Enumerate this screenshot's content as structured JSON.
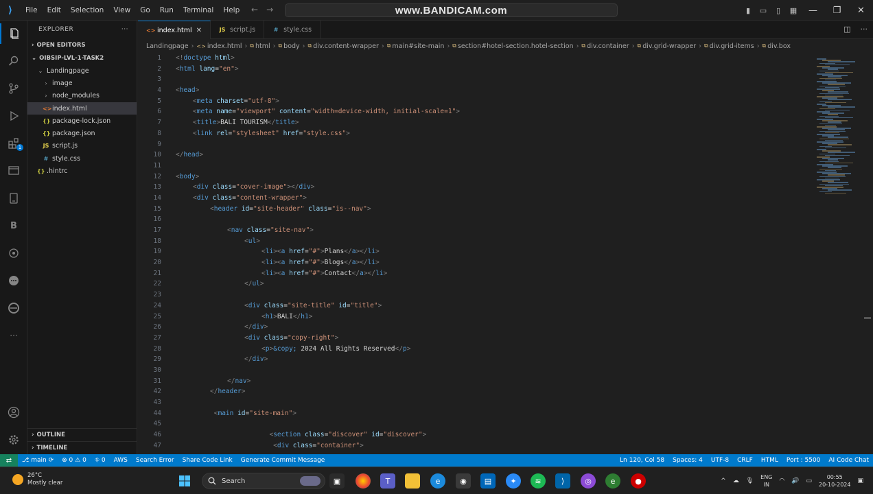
{
  "window": {
    "watermark": "www.BANDICAM.com",
    "menu": [
      "File",
      "Edit",
      "Selection",
      "View",
      "Go",
      "Run",
      "Terminal",
      "Help"
    ]
  },
  "sidebar": {
    "title": "EXPLORER",
    "more": "···",
    "open_editors": "OPEN EDITORS",
    "workspace": "OIBSIP-LVL-1-TASK2",
    "tree": [
      {
        "label": "Landingpage",
        "depth": 1,
        "kind": "folder-open",
        "selected": false
      },
      {
        "label": "image",
        "depth": 2,
        "kind": "folder",
        "selected": false
      },
      {
        "label": "node_modules",
        "depth": 2,
        "kind": "folder",
        "selected": false
      },
      {
        "label": "index.html",
        "depth": 2,
        "kind": "html",
        "selected": true
      },
      {
        "label": "package-lock.json",
        "depth": 2,
        "kind": "json",
        "selected": false
      },
      {
        "label": "package.json",
        "depth": 2,
        "kind": "json",
        "selected": false
      },
      {
        "label": "script.js",
        "depth": 2,
        "kind": "js",
        "selected": false
      },
      {
        "label": "style.css",
        "depth": 2,
        "kind": "css",
        "selected": false
      },
      {
        "label": ".hintrc",
        "depth": 1,
        "kind": "config",
        "selected": false
      }
    ],
    "outline": "OUTLINE",
    "timeline": "TIMELINE"
  },
  "tabs": [
    {
      "label": "index.html",
      "active": true,
      "kind": "html"
    },
    {
      "label": "script.js",
      "active": false,
      "kind": "js"
    },
    {
      "label": "style.css",
      "active": false,
      "kind": "css"
    }
  ],
  "breadcrumb": [
    "Landingpage",
    "index.html",
    "html",
    "body",
    "div.content-wrapper",
    "main#site-main",
    "section#hotel-section.hotel-section",
    "div.container",
    "div.grid-wrapper",
    "div.grid-items",
    "div.box"
  ],
  "code": [
    {
      "n": "1",
      "indent": 0,
      "t": [
        [
          "p",
          "<!"
        ],
        [
          "g",
          "doctype "
        ],
        [
          "a",
          "html"
        ],
        [
          "p",
          ">"
        ]
      ]
    },
    {
      "n": "2",
      "indent": 0,
      "t": [
        [
          "p",
          "<"
        ],
        [
          "g",
          "html "
        ],
        [
          "a",
          "lang"
        ],
        [
          "x",
          "="
        ],
        [
          "s",
          "\"en\""
        ],
        [
          "p",
          ">"
        ]
      ]
    },
    {
      "n": "3",
      "indent": 0,
      "t": []
    },
    {
      "n": "4",
      "indent": 0,
      "t": [
        [
          "p",
          "<"
        ],
        [
          "g",
          "head"
        ],
        [
          "p",
          ">"
        ]
      ]
    },
    {
      "n": "5",
      "indent": 1,
      "t": [
        [
          "p",
          "<"
        ],
        [
          "g",
          "meta "
        ],
        [
          "a",
          "charset"
        ],
        [
          "x",
          "="
        ],
        [
          "s",
          "\"utf-8\""
        ],
        [
          "p",
          ">"
        ]
      ]
    },
    {
      "n": "6",
      "indent": 1,
      "t": [
        [
          "p",
          "<"
        ],
        [
          "g",
          "meta "
        ],
        [
          "a",
          "name"
        ],
        [
          "x",
          "="
        ],
        [
          "s",
          "\"viewport\" "
        ],
        [
          "a",
          "content"
        ],
        [
          "x",
          "="
        ],
        [
          "s",
          "\"width=device-width, initial-scale=1\""
        ],
        [
          "p",
          ">"
        ]
      ]
    },
    {
      "n": "7",
      "indent": 1,
      "t": [
        [
          "p",
          "<"
        ],
        [
          "g",
          "title"
        ],
        [
          "p",
          ">"
        ],
        [
          "x",
          "BALI TOURISM"
        ],
        [
          "p",
          "</"
        ],
        [
          "g",
          "title"
        ],
        [
          "p",
          ">"
        ]
      ]
    },
    {
      "n": "8",
      "indent": 1,
      "t": [
        [
          "p",
          "<"
        ],
        [
          "g",
          "link "
        ],
        [
          "a",
          "rel"
        ],
        [
          "x",
          "="
        ],
        [
          "s",
          "\"stylesheet\" "
        ],
        [
          "a",
          "href"
        ],
        [
          "x",
          "="
        ],
        [
          "s",
          "\"style.css\""
        ],
        [
          "p",
          ">"
        ]
      ]
    },
    {
      "n": "9",
      "indent": 0,
      "t": []
    },
    {
      "n": "10",
      "indent": 0,
      "t": [
        [
          "p",
          "</"
        ],
        [
          "g",
          "head"
        ],
        [
          "p",
          ">"
        ]
      ]
    },
    {
      "n": "11",
      "indent": 0,
      "t": []
    },
    {
      "n": "12",
      "indent": 0,
      "t": [
        [
          "p",
          "<"
        ],
        [
          "g",
          "body"
        ],
        [
          "p",
          ">"
        ]
      ]
    },
    {
      "n": "13",
      "indent": 1,
      "t": [
        [
          "p",
          "<"
        ],
        [
          "g",
          "div "
        ],
        [
          "a",
          "class"
        ],
        [
          "x",
          "="
        ],
        [
          "s",
          "\"cover-image\""
        ],
        [
          "p",
          "></"
        ],
        [
          "g",
          "div"
        ],
        [
          "p",
          ">"
        ]
      ]
    },
    {
      "n": "14",
      "indent": 1,
      "t": [
        [
          "p",
          "<"
        ],
        [
          "g",
          "div "
        ],
        [
          "a",
          "class"
        ],
        [
          "x",
          "="
        ],
        [
          "s",
          "\"content-wrapper\""
        ],
        [
          "p",
          ">"
        ]
      ]
    },
    {
      "n": "15",
      "indent": 2,
      "t": [
        [
          "p",
          "<"
        ],
        [
          "g",
          "header "
        ],
        [
          "a",
          "id"
        ],
        [
          "x",
          "="
        ],
        [
          "s",
          "\"site-header\" "
        ],
        [
          "a",
          "class"
        ],
        [
          "x",
          "="
        ],
        [
          "s",
          "\"is--nav\""
        ],
        [
          "p",
          ">"
        ]
      ]
    },
    {
      "n": "16",
      "indent": 0,
      "t": []
    },
    {
      "n": "17",
      "indent": 3,
      "t": [
        [
          "p",
          "<"
        ],
        [
          "g",
          "nav "
        ],
        [
          "a",
          "class"
        ],
        [
          "x",
          "="
        ],
        [
          "s",
          "\"site-nav\""
        ],
        [
          "p",
          ">"
        ]
      ]
    },
    {
      "n": "18",
      "indent": 4,
      "t": [
        [
          "p",
          "<"
        ],
        [
          "g",
          "ul"
        ],
        [
          "p",
          ">"
        ]
      ]
    },
    {
      "n": "19",
      "indent": 5,
      "t": [
        [
          "p",
          "<"
        ],
        [
          "g",
          "li"
        ],
        [
          "p",
          "><"
        ],
        [
          "g",
          "a "
        ],
        [
          "a",
          "href"
        ],
        [
          "x",
          "="
        ],
        [
          "s",
          "\"#\""
        ],
        [
          "p",
          ">"
        ],
        [
          "x",
          "Plans"
        ],
        [
          "p",
          "</"
        ],
        [
          "g",
          "a"
        ],
        [
          "p",
          "></"
        ],
        [
          "g",
          "li"
        ],
        [
          "p",
          ">"
        ]
      ]
    },
    {
      "n": "20",
      "indent": 5,
      "t": [
        [
          "p",
          "<"
        ],
        [
          "g",
          "li"
        ],
        [
          "p",
          "><"
        ],
        [
          "g",
          "a "
        ],
        [
          "a",
          "href"
        ],
        [
          "x",
          "="
        ],
        [
          "s",
          "\"#\""
        ],
        [
          "p",
          ">"
        ],
        [
          "x",
          "Blogs"
        ],
        [
          "p",
          "</"
        ],
        [
          "g",
          "a"
        ],
        [
          "p",
          "></"
        ],
        [
          "g",
          "li"
        ],
        [
          "p",
          ">"
        ]
      ]
    },
    {
      "n": "21",
      "indent": 5,
      "t": [
        [
          "p",
          "<"
        ],
        [
          "g",
          "li"
        ],
        [
          "p",
          "><"
        ],
        [
          "g",
          "a "
        ],
        [
          "a",
          "href"
        ],
        [
          "x",
          "="
        ],
        [
          "s",
          "\"#\""
        ],
        [
          "p",
          ">"
        ],
        [
          "x",
          "Contact"
        ],
        [
          "p",
          "</"
        ],
        [
          "g",
          "a"
        ],
        [
          "p",
          "></"
        ],
        [
          "g",
          "li"
        ],
        [
          "p",
          ">"
        ]
      ]
    },
    {
      "n": "22",
      "indent": 4,
      "t": [
        [
          "p",
          "</"
        ],
        [
          "g",
          "ul"
        ],
        [
          "p",
          ">"
        ]
      ]
    },
    {
      "n": "23",
      "indent": 0,
      "t": []
    },
    {
      "n": "24",
      "indent": 4,
      "t": [
        [
          "p",
          "<"
        ],
        [
          "g",
          "div "
        ],
        [
          "a",
          "class"
        ],
        [
          "x",
          "="
        ],
        [
          "s",
          "\"site-title\" "
        ],
        [
          "a",
          "id"
        ],
        [
          "x",
          "="
        ],
        [
          "s",
          "\"title\""
        ],
        [
          "p",
          ">"
        ]
      ]
    },
    {
      "n": "25",
      "indent": 5,
      "t": [
        [
          "p",
          "<"
        ],
        [
          "g",
          "h1"
        ],
        [
          "p",
          ">"
        ],
        [
          "x",
          "BALI"
        ],
        [
          "p",
          "</"
        ],
        [
          "g",
          "h1"
        ],
        [
          "p",
          ">"
        ]
      ]
    },
    {
      "n": "26",
      "indent": 4,
      "t": [
        [
          "p",
          "</"
        ],
        [
          "g",
          "div"
        ],
        [
          "p",
          ">"
        ]
      ]
    },
    {
      "n": "27",
      "indent": 4,
      "t": [
        [
          "p",
          "<"
        ],
        [
          "g",
          "div "
        ],
        [
          "a",
          "class"
        ],
        [
          "x",
          "="
        ],
        [
          "s",
          "\"copy-right\""
        ],
        [
          "p",
          ">"
        ]
      ]
    },
    {
      "n": "28",
      "indent": 5,
      "t": [
        [
          "p",
          "<"
        ],
        [
          "g",
          "p"
        ],
        [
          "p",
          ">"
        ],
        [
          "e",
          "&copy;"
        ],
        [
          "x",
          " 2024 All Rights Reserved"
        ],
        [
          "p",
          "</"
        ],
        [
          "g",
          "p"
        ],
        [
          "p",
          ">"
        ]
      ]
    },
    {
      "n": "29",
      "indent": 4,
      "t": [
        [
          "p",
          "</"
        ],
        [
          "g",
          "div"
        ],
        [
          "p",
          ">"
        ]
      ]
    },
    {
      "n": "30",
      "indent": 0,
      "t": []
    },
    {
      "n": "31",
      "indent": 3,
      "t": [
        [
          "p",
          "</"
        ],
        [
          "g",
          "nav"
        ],
        [
          "p",
          ">"
        ]
      ]
    },
    {
      "n": "42",
      "indent": 2,
      "t": [
        [
          "p",
          "</"
        ],
        [
          "g",
          "header"
        ],
        [
          "p",
          ">"
        ]
      ]
    },
    {
      "n": "43",
      "indent": 0,
      "t": []
    },
    {
      "n": "44",
      "indent": 2,
      "t": [
        [
          "x",
          " "
        ],
        [
          "p",
          "<"
        ],
        [
          "g",
          "main "
        ],
        [
          "a",
          "id"
        ],
        [
          "x",
          "="
        ],
        [
          "s",
          "\"site-main\""
        ],
        [
          "p",
          ">"
        ]
      ]
    },
    {
      "n": "45",
      "indent": 0,
      "t": []
    },
    {
      "n": "46",
      "indent": 5,
      "t": [
        [
          "x",
          "  "
        ],
        [
          "p",
          "<"
        ],
        [
          "g",
          "section "
        ],
        [
          "a",
          "class"
        ],
        [
          "x",
          "="
        ],
        [
          "s",
          "\"discover\" "
        ],
        [
          "a",
          "id"
        ],
        [
          "x",
          "="
        ],
        [
          "s",
          "\"discover\""
        ],
        [
          "p",
          ">"
        ]
      ]
    },
    {
      "n": "47",
      "indent": 5,
      "t": [
        [
          "x",
          "   "
        ],
        [
          "p",
          "<"
        ],
        [
          "g",
          "div "
        ],
        [
          "a",
          "class"
        ],
        [
          "x",
          "="
        ],
        [
          "s",
          "\"container\""
        ],
        [
          "p",
          ">"
        ]
      ]
    }
  ],
  "status": {
    "branch": "main",
    "errors": "0",
    "warnings": "0",
    "ports": "0",
    "left": [
      "AWS",
      "Search Error",
      "Share Code Link",
      "Generate Commit Message"
    ],
    "right": [
      "Ln 120, Col 58",
      "Spaces: 4",
      "UTF-8",
      "CRLF",
      "HTML",
      "Port : 5500",
      "AI Code Chat"
    ]
  },
  "taskbar": {
    "weather_temp": "26°C",
    "weather_desc": "Mostly clear",
    "search_placeholder": "Search",
    "lang_1": "ENG",
    "lang_2": "IN",
    "time": "00:55",
    "date": "20-10-2024"
  },
  "colors": {
    "accent": "#007acc",
    "remote": "#16825d",
    "tag": "#569cd6",
    "attr": "#9cdcfe",
    "string": "#ce9178"
  }
}
